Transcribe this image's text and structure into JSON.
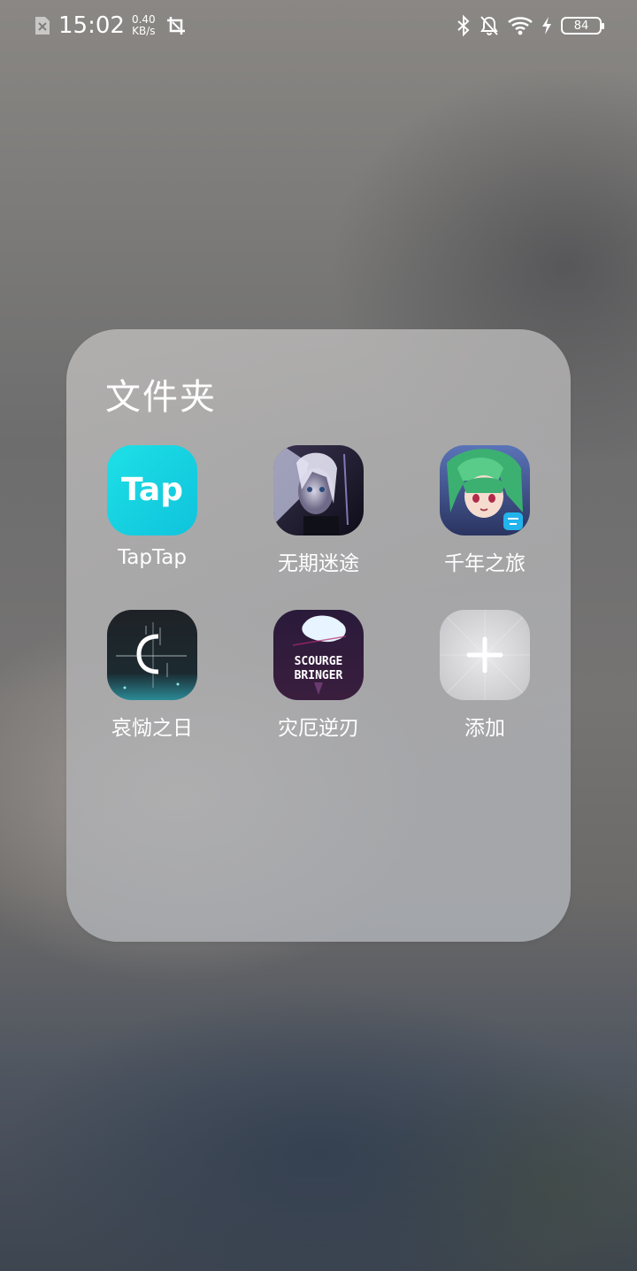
{
  "status_bar": {
    "time": "15:02",
    "net_speed_value": "0.40",
    "net_speed_unit": "KB/s",
    "battery_level": "84",
    "icons": [
      "sim-off-icon",
      "screenshot-icon",
      "bluetooth-icon",
      "notifications-off-icon",
      "wifi-icon",
      "charging-icon",
      "battery-icon"
    ]
  },
  "folder": {
    "title": "文件夹",
    "apps": [
      {
        "label": "TapTap",
        "icon": "taptap-app-icon",
        "icon_text": "Tap"
      },
      {
        "label": "无期迷途",
        "icon": "wuqimitu-app-icon"
      },
      {
        "label": "千年之旅",
        "icon": "qiannianzhilv-app-icon"
      },
      {
        "label": "哀恸之日",
        "icon": "aitongzhiri-app-icon"
      },
      {
        "label": "灾厄逆刃",
        "icon": "scourgebringer-app-icon",
        "icon_text_line1": "SCOURGE",
        "icon_text_line2": "BRINGER"
      },
      {
        "label": "添加",
        "icon": "add-app-icon"
      }
    ]
  },
  "colors": {
    "taptap_teal": "#14d2e0",
    "folder_bg": "#b4b4b6",
    "text": "#ffffff"
  }
}
